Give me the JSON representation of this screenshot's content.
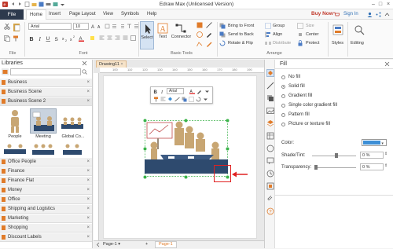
{
  "window": {
    "title": "Edraw Max (Unlicensed Version)"
  },
  "menubar": {
    "file": "File",
    "items": [
      "Home",
      "Insert",
      "Page Layout",
      "View",
      "Symbols",
      "Help"
    ],
    "buy_now": "Buy Now",
    "sign_in": "Sign In"
  },
  "ribbon": {
    "font_name": "Arial",
    "font_size": "10",
    "group_file": "File",
    "group_font": "Font",
    "group_basic_tools": "Basic Tools",
    "group_arrange": "Arrange",
    "select_label": "Select",
    "text_label": "Text",
    "connector_label": "Connector",
    "bring_to_front": "Bring to Front",
    "send_to_back": "Send to Back",
    "rotate_flip": "Rotate & Flip",
    "group": "Group",
    "align": "Align",
    "distribute": "Distribute",
    "size": "Size",
    "center": "Center",
    "protect": "Protect",
    "styles": "Styles",
    "editing": "Editing"
  },
  "libraries": {
    "header": "Libraries",
    "top_rows": [
      "Business",
      "Business Scene",
      "Business Scene 2"
    ],
    "shapes": [
      {
        "label": "People"
      },
      {
        "label": "Meeting"
      },
      {
        "label": "Global Co..."
      }
    ],
    "bottom_rows": [
      "Office People",
      "Finance",
      "Finance Flat",
      "Money",
      "Office",
      "Shipping and Logistics",
      "Marketing",
      "Shopping",
      "Discount Labels"
    ]
  },
  "canvas": {
    "tab": "Drawing11",
    "mini_font": "Arial",
    "page_tab": "Page-1",
    "page_tab2": "Page-1",
    "ruler_marks": [
      "100",
      "110",
      "120",
      "130",
      "140",
      "150",
      "160",
      "170",
      "180",
      "190",
      "200"
    ]
  },
  "fill_panel": {
    "header": "Fill",
    "options": [
      {
        "label": "No fill",
        "selected": false
      },
      {
        "label": "Solid fill",
        "selected": true
      },
      {
        "label": "Gradient fill",
        "selected": false
      },
      {
        "label": "Single color gradient fill",
        "selected": false
      },
      {
        "label": "Pattern fill",
        "selected": false
      },
      {
        "label": "Picture or texture fill",
        "selected": false
      }
    ],
    "color_label": "Color:",
    "color_value": "#3d8fd6",
    "shade_label": "Shade/Tint:",
    "shade_value": "0 %",
    "transparency_label": "Transparency:",
    "transparency_value": "0 %"
  },
  "colors": {
    "menubar_file_bg": "#2d3a4d",
    "accent_orange": "#e07b29",
    "selection_green": "#3bb34a",
    "arrow_red": "#e02020",
    "navy_table": "#2e4a6e",
    "tan_people": "#c8a673"
  }
}
